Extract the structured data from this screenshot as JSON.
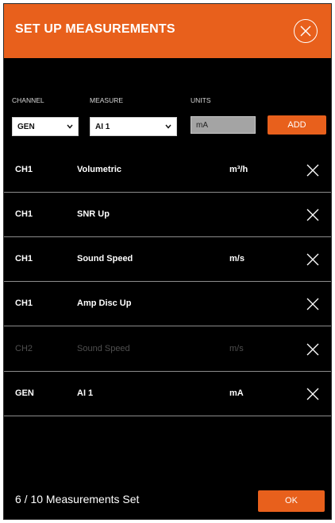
{
  "dialog": {
    "title": "SET UP MEASUREMENTS",
    "close_icon": "close-circle-icon"
  },
  "form": {
    "channel_label": "CHANNEL",
    "channel_value": "GEN",
    "measure_label": "MEASURE",
    "measure_value": "AI 1",
    "units_label": "UNITS",
    "units_value": "mA",
    "add_label": "ADD"
  },
  "measurements": [
    {
      "channel": "CH1",
      "measure": "Volumetric",
      "units": "m³/h",
      "enabled": true
    },
    {
      "channel": "CH1",
      "measure": "SNR Up",
      "units": "",
      "enabled": true
    },
    {
      "channel": "CH1",
      "measure": "Sound Speed",
      "units": "m/s",
      "enabled": true
    },
    {
      "channel": "CH1",
      "measure": "Amp Disc Up",
      "units": "",
      "enabled": true
    },
    {
      "channel": "CH2",
      "measure": "Sound Speed",
      "units": "m/s",
      "enabled": false
    },
    {
      "channel": "GEN",
      "measure": "AI 1",
      "units": "mA",
      "enabled": true
    }
  ],
  "footer": {
    "count_text": "6 / 10 Measurements Set",
    "ok_label": "OK"
  },
  "colors": {
    "accent": "#e8601c",
    "background": "#000000",
    "text": "#ffffff",
    "disabled_text": "#4f4f4f",
    "divider": "#8c8c8c"
  }
}
